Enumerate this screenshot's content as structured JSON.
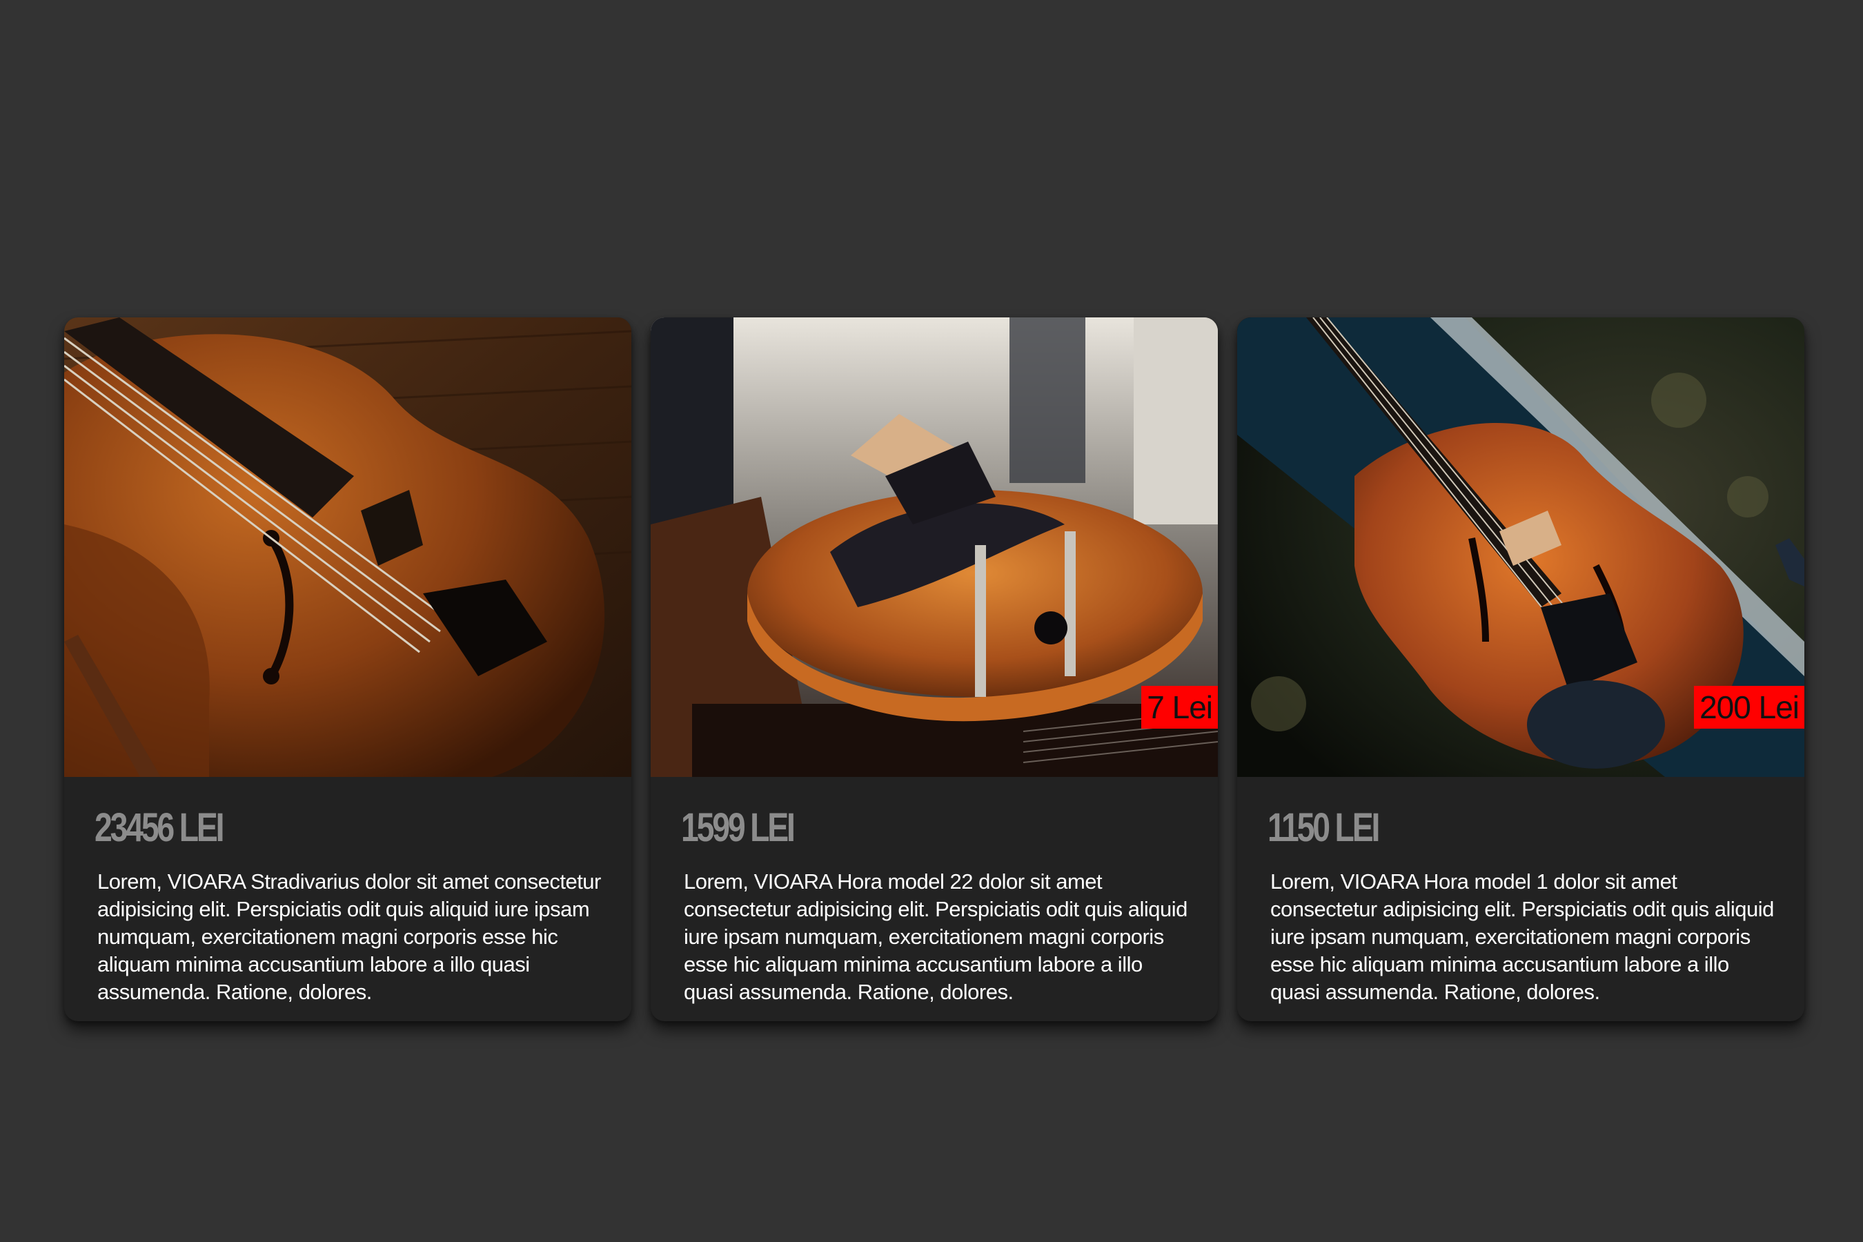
{
  "products": [
    {
      "price": "23456 LEI",
      "description": "Lorem, VIOARA Stradivarius dolor sit amet consectetur adipisicing elit. Perspiciatis odit quis aliquid iure ipsam numquam, exercitationem magni corporis esse hic aliquam minima accusantium labore a illo quasi assumenda. Ratione, dolores.",
      "image": "violin-photo"
    },
    {
      "price": "1599 LEI",
      "badge": "7 Lei",
      "description": "Lorem, VIOARA Hora model 22 dolor sit amet consectetur adipisicing elit. Perspiciatis odit quis aliquid iure ipsam numquam, exercitationem magni corporis esse hic aliquam minima accusantium labore a illo quasi assumenda. Ratione, dolores.",
      "image": "violin-photo"
    },
    {
      "price": "1150 LEI",
      "badge": "200 Lei",
      "description": "Lorem, VIOARA Hora model 1 dolor sit amet consectetur adipisicing elit. Perspiciatis odit quis aliquid iure ipsam numquam, exercitationem magni corporis esse hic aliquam minima accusantium labore a illo quasi assumenda. Ratione, dolores.",
      "image": "violin-photo"
    }
  ],
  "colors": {
    "background": "#333333",
    "card": "#222222",
    "badge": "#ff0000",
    "price": "#8c8c8c"
  }
}
